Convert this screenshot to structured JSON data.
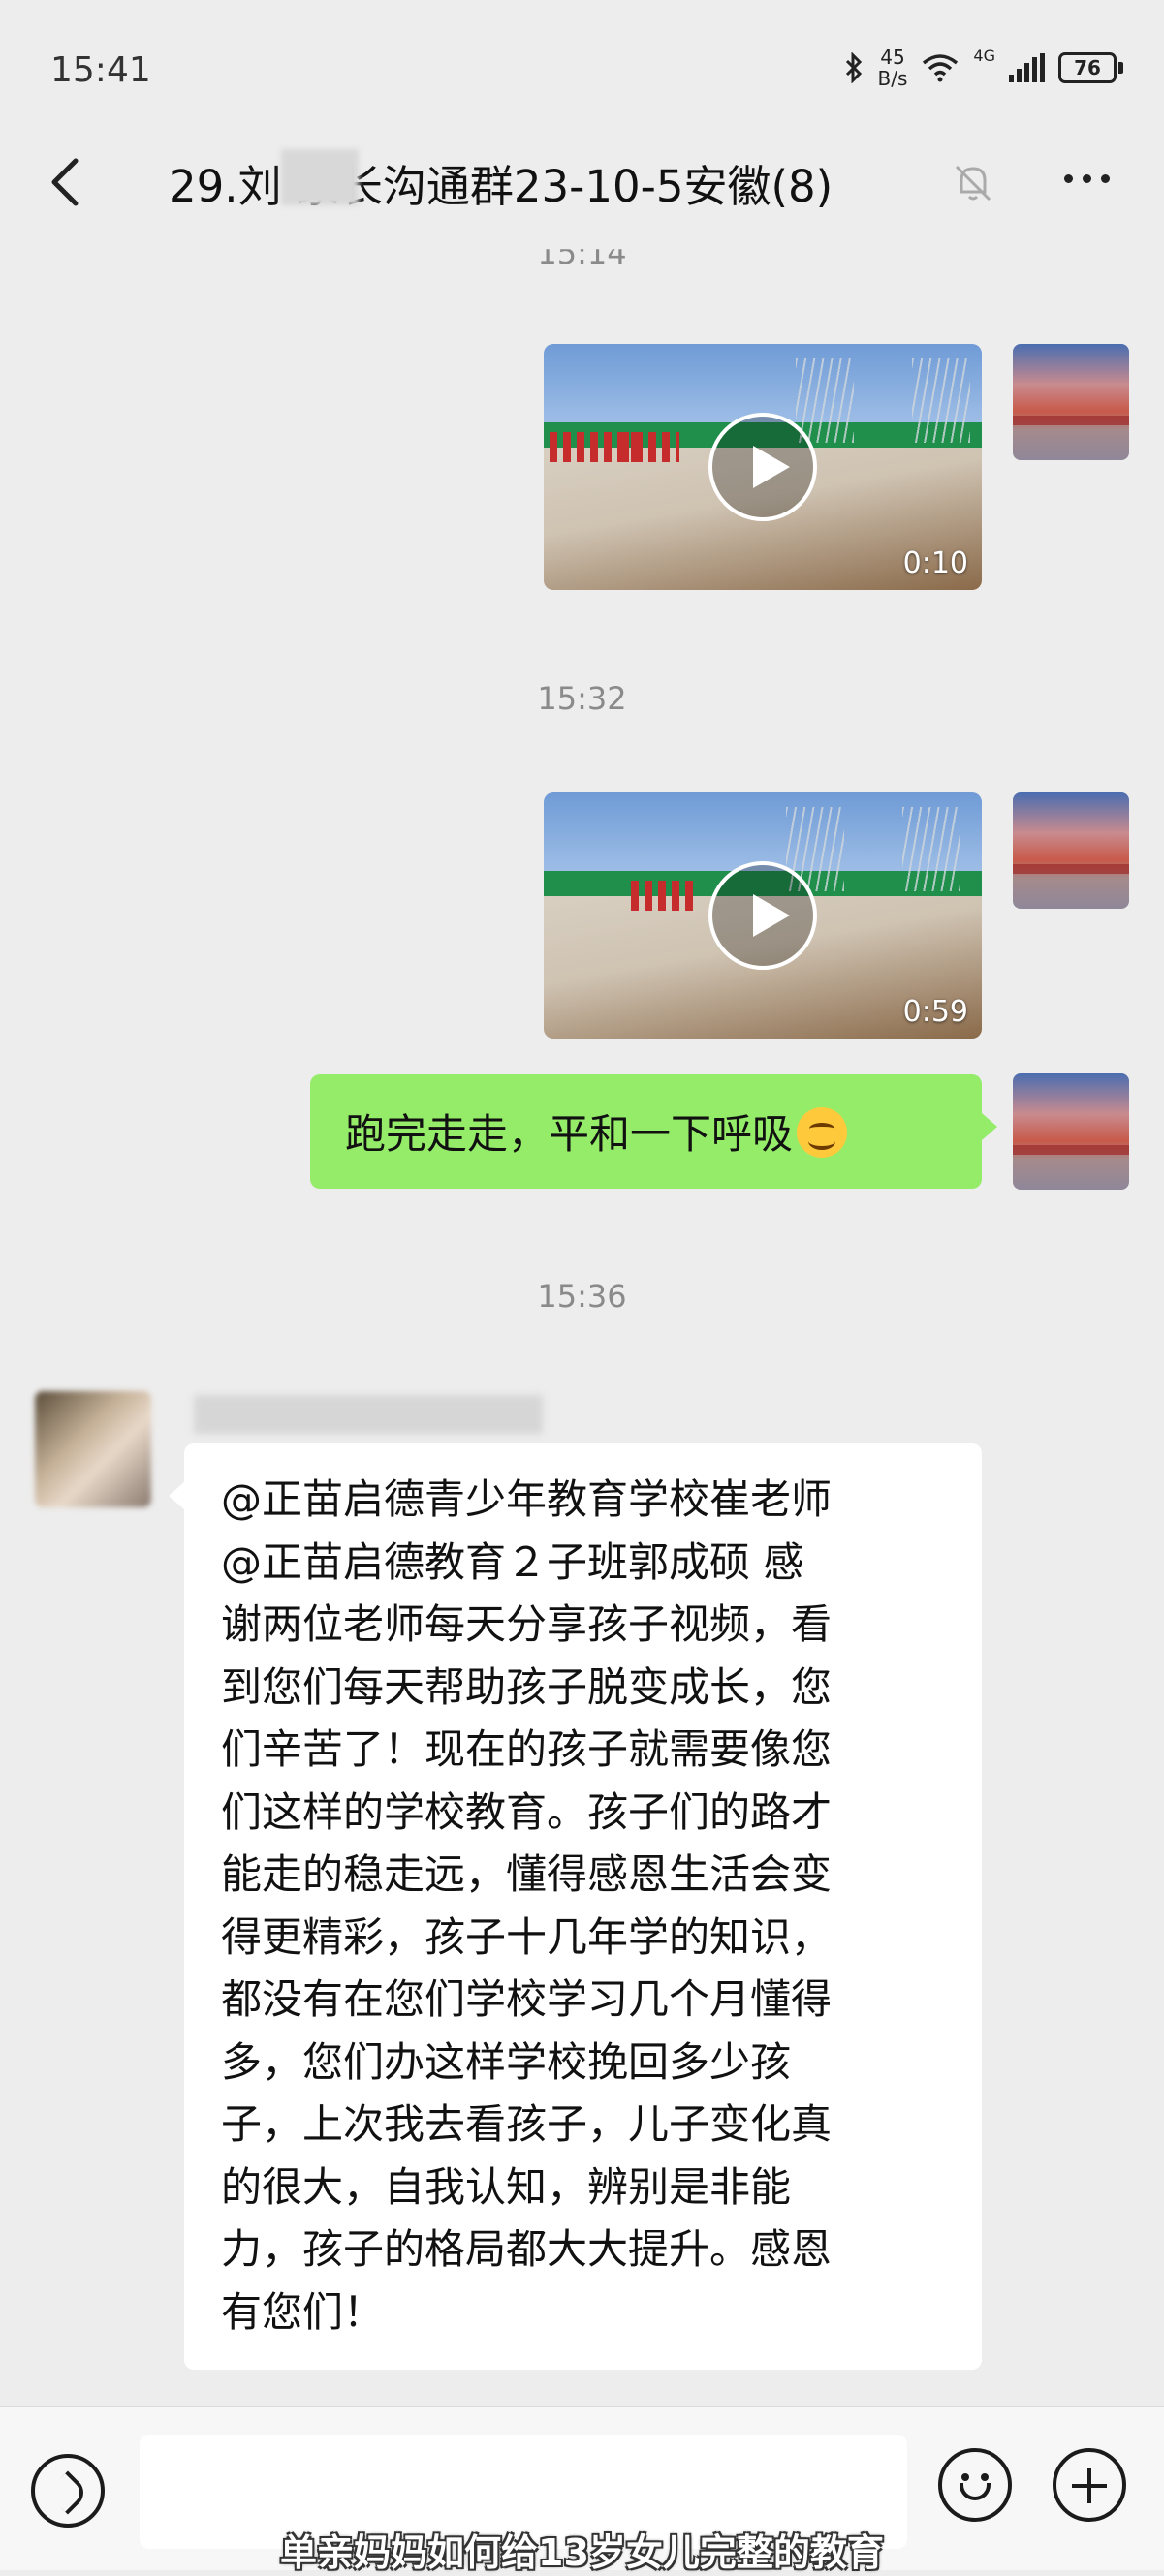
{
  "status_bar": {
    "time": "15:41",
    "net_speed_value": "45",
    "net_speed_unit": "B/s",
    "net_type": "4G",
    "battery": "76",
    "icons": [
      "bluetooth-icon",
      "wifi-icon",
      "signal-icon",
      "battery-icon"
    ]
  },
  "nav": {
    "title": "29.刘  家长沟通群23-10-5安徽(8)",
    "icons": [
      "back-icon",
      "mute-bell-icon",
      "more-icon"
    ]
  },
  "messages": {
    "ts_top_partial": "15:14",
    "video1": {
      "duration": "0:10"
    },
    "ts_1532": "15:32",
    "video2": {
      "duration": "0:59"
    },
    "sent_text": "跑完走走，平和一下呼吸",
    "sent_emoji": "smile-emoji",
    "ts_1536": "15:36",
    "received_lines": [
      "@正苗启德青少年教育学校崔老师",
      "@正苗启德教育２子班郭成硕  感",
      "谢两位老师每天分享孩子视频，看",
      "到您们每天帮助孩子脱变成长，您",
      "们辛苦了！现在的孩子就需要像您",
      "们这样的学校教育。孩子们的路才",
      "能走的稳走远，懂得感恩生活会变",
      "得更精彩，孩子十几年学的知识，",
      "都没有在您们学校学习几个月懂得",
      "多，您们办这样学校挽回多少孩",
      "子，上次我去看孩子，儿子变化真",
      "的很大，自我认知，辨别是非能",
      "力，孩子的格局都大大提升。感恩",
      "有您们！"
    ]
  },
  "input_bar": {
    "icons": [
      "voice-icon",
      "emoji-icon",
      "plus-icon"
    ],
    "caption": "单亲妈妈如何给13岁女儿完整的教育"
  },
  "colors": {
    "background": "#ededed",
    "sent_bubble": "#95ec69",
    "received_bubble": "#ffffff"
  }
}
